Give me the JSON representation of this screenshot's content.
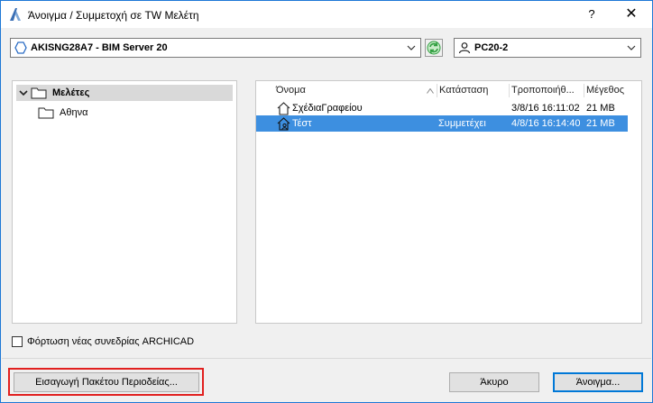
{
  "window": {
    "title": "Άνοιγμα / Συμμετοχή σε TW Μελέτη",
    "help_label": "?",
    "close_label": "✕"
  },
  "server": {
    "selected": "AKISNG28A7 - BIM Server 20"
  },
  "user": {
    "selected": "PC20-2"
  },
  "tree": {
    "root_label": "Μελέτες",
    "children": [
      "Αθηνα"
    ]
  },
  "list": {
    "columns": [
      "Όνομα",
      "Κατάσταση",
      "Τροποποιήθ...",
      "Μέγεθος"
    ],
    "rows": [
      {
        "name": "ΣχέδιαΓραφείου",
        "status": "",
        "modified": "3/8/16 16:11:02",
        "size": "21 MB",
        "selected": false
      },
      {
        "name": "Τέστ",
        "status": "Συμμετέχει",
        "modified": "4/8/16 16:14:40",
        "size": "21 MB",
        "selected": true
      }
    ]
  },
  "options": {
    "load_new_session_label": "Φόρτωση νέας συνεδρίας ARCHICAD",
    "load_new_session_checked": false
  },
  "buttons": {
    "import_label": "Εισαγωγή Πακέτου Περιοδείας...",
    "cancel_label": "Άκυρο",
    "open_label": "Άνοιγμα..."
  },
  "colors": {
    "selection": "#3d8fe0",
    "highlight_box": "#e1201f",
    "window_border": "#1e78d6",
    "refresh_icon": "#2e9e3e"
  }
}
